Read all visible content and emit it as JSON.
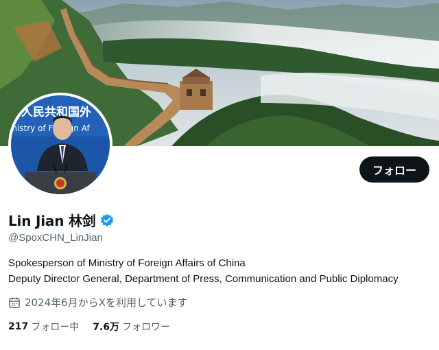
{
  "profile": {
    "display_name": "Lin Jian 林剑",
    "handle": "@SpoxCHN_LinJian",
    "verified": true,
    "verified_color": "#1d9bf0",
    "bio_lines": [
      "Spokesperson of Ministry of Foreign Affairs of China",
      "Deputy Director General, Department of Press, Communication and Public Diplomacy"
    ],
    "joined": "2024年6月からXを利用しています",
    "joined_icon": "calendar-icon",
    "follow_button": "フォロー"
  },
  "avatar_backdrop": {
    "line1": "华人民共和国外",
    "line2": "inistry of Foreign Af"
  },
  "stats": {
    "following_count": "217",
    "following_label": "フォロー中",
    "followers_count": "7.6万",
    "followers_label": "フォロワー"
  },
  "colors": {
    "text_primary": "#0f1419",
    "text_secondary": "#536471",
    "button_bg": "#0f1419",
    "avatar_backdrop": "#1c56a8"
  }
}
